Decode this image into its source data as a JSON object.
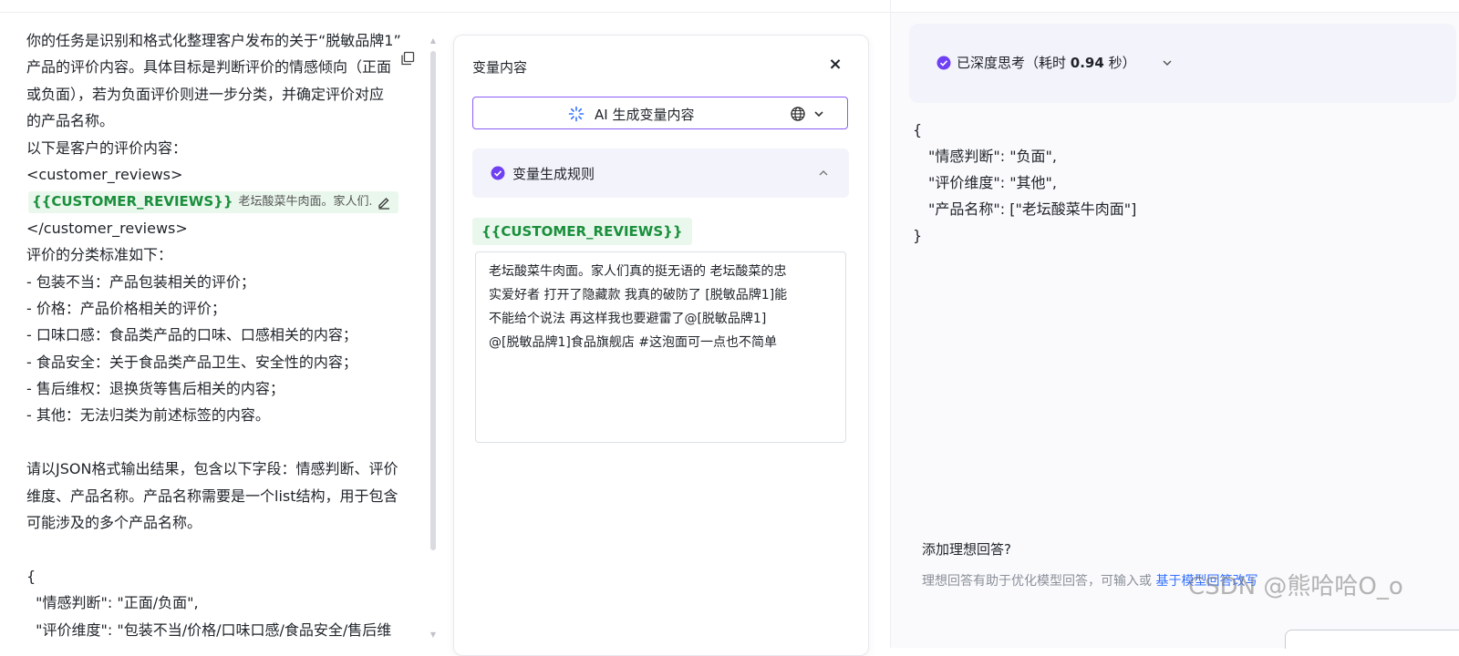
{
  "prompt": {
    "lines": [
      "你的任务是识别和格式化整理客户发布的关于“脱敏品牌1”",
      "产品的评价内容。具体目标是判断评价的情感倾向（正面",
      "或负面），若为负面评价则进一步分类，并确定评价对应",
      "的产品名称。",
      "以下是客户的评价内容：",
      "<customer_reviews>"
    ],
    "variable_chip": {
      "name": "{{CUSTOMER_REVIEWS}}",
      "preview": "老坛酸菜牛肉面。家人们..."
    },
    "lines_after": [
      "</customer_reviews>",
      "评价的分类标准如下：",
      "- 包装不当：产品包装相关的评价；",
      "- 价格：产品价格相关的评价；",
      "- 口味口感：食品类产品的口味、口感相关的内容；",
      "- 食品安全：关于食品类产品卫生、安全性的内容；",
      "- 售后维权：退换货等售后相关的内容；",
      "- 其他：无法归类为前述标签的内容。",
      "",
      "请以JSON格式输出结果，包含以下字段：情感判断、评价",
      "维度、产品名称。产品名称需要是一个list结构，用于包含",
      "可能涉及的多个产品名称。",
      "",
      "{",
      "  \"情感判断\": \"正面/负面\",",
      "  \"评价维度\": \"包装不当/价格/口味口感/食品安全/售后维"
    ]
  },
  "variable_panel": {
    "title": "变量内容",
    "close": "×",
    "ai_generate_label": "AI 生成变量内容",
    "rule_label": "变量生成规则",
    "variable_tag": "{{CUSTOMER_REVIEWS}}",
    "value_lines": [
      "老坛酸菜牛肉面。家人们真的挺无语的 老坛酸菜的忠",
      "实爱好者 打开了隐藏款 我真的破防了 [脱敏品牌1]能",
      "不能给个说法 再这样我也要避雷了@[脱敏品牌1]",
      "@[脱敏品牌1]食品旗舰店 #这泡面可一点也不简单"
    ]
  },
  "output": {
    "thinking_prefix": "已深度思考（耗时 ",
    "thinking_time": "0.94",
    "thinking_suffix": " 秒）",
    "json_lines": [
      "{",
      "\"情感判断\": \"负面\",",
      "\"评价维度\": \"其他\",",
      "\"产品名称\": [\"老坛酸菜牛肉面\"]",
      "}"
    ],
    "ideal_title": "添加理想回答?",
    "ideal_hint": "理想回答有助于优化模型回答，可输入或 ",
    "ideal_link": "基于模型回答改写"
  },
  "watermark": "CSDN @熊哈哈O_o",
  "colors": {
    "accent_purple": "#8b5cf6",
    "check_purple": "#6e3ff3",
    "variable_green": "#1a8f3c",
    "variable_bg": "#eaf7ed",
    "link_blue": "#3370ff"
  }
}
